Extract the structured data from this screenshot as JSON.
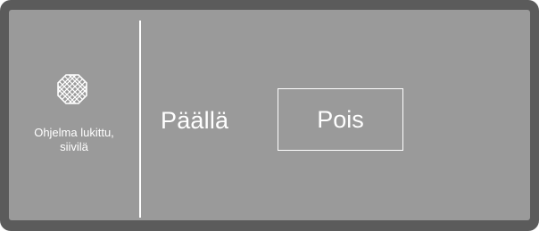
{
  "status": {
    "icon": "lock-strainer-icon",
    "line1": "Ohjelma lukittu,",
    "line2": "siivilä"
  },
  "options": {
    "on_label": "Päällä",
    "off_label": "Pois",
    "selected": "off"
  },
  "colors": {
    "bezel": "#5b5b5b",
    "screen": "#9a9a9a",
    "foreground": "#ffffff"
  }
}
